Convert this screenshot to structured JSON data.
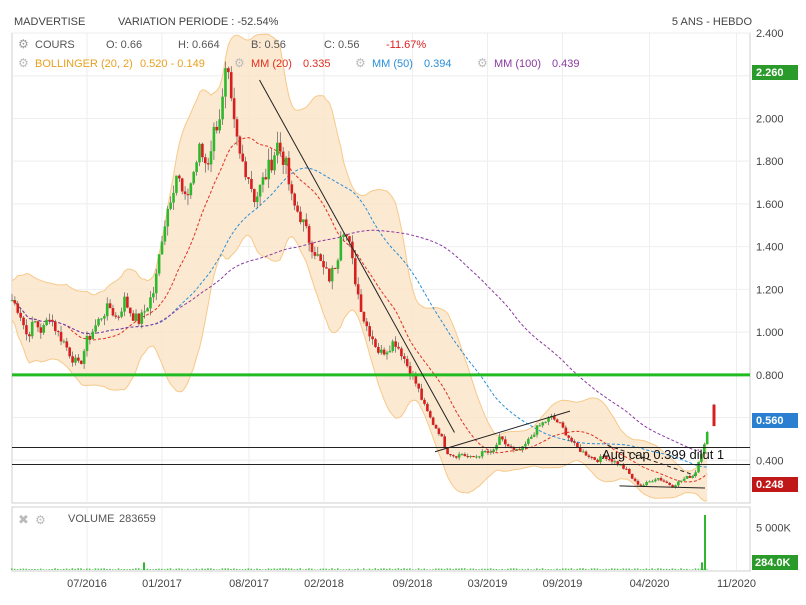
{
  "header": {
    "symbol": "MADVERTISE",
    "variation": "VARIATION PERIODE : -52.54%",
    "period": "5 ANS - HEBDO"
  },
  "legend": {
    "cours": {
      "label": "COURS",
      "o": "O: 0.66",
      "h": "H: 0.664",
      "b": "B: 0.56",
      "c": "C: 0.56",
      "chg": "-11.67%"
    },
    "bollinger": {
      "label": "BOLLINGER (20, 2)",
      "value": "0.520 - 0.149"
    },
    "mm20": {
      "label": "MM (20)",
      "value": "0.335"
    },
    "mm50": {
      "label": "MM (50)",
      "value": "0.394"
    },
    "mm100": {
      "label": "MM (100)",
      "value": "0.439"
    }
  },
  "volume_legend": {
    "label": "VOLUME",
    "value": "283659"
  },
  "badges": {
    "level_high": "2.260",
    "last_price": "0.560",
    "level_low": "0.248",
    "last_volume": "284.0K"
  },
  "annotation": "Aug cap 0.399 dilut 1",
  "colors": {
    "up": "#2db82d",
    "down": "#d62020",
    "band": "#f7c98a",
    "band_fill": "#fbe3c6",
    "mm20": "#e03020",
    "mm50": "#2a8fd8",
    "mm100": "#8a3aa0",
    "support": "#22bb22",
    "legend_orange": "#e8a020",
    "legend_blue": "#2a8fd8",
    "legend_purple": "#8a3aa0",
    "legend_red": "#e03020"
  },
  "chart_data": {
    "type": "candlestick",
    "price_axis": {
      "min": 0.2,
      "max": 2.4,
      "ticks": [
        0.4,
        0.6,
        0.8,
        1.0,
        1.2,
        1.4,
        1.6,
        1.8,
        2.0,
        2.2,
        2.4
      ],
      "tick_labels": [
        "0.400",
        "0.600",
        "0.800",
        "1.000",
        "1.200",
        "1.400",
        "1.600",
        "1.800",
        "2.000",
        "2.200",
        "2.400"
      ]
    },
    "volume_axis": {
      "ticks": [
        5000000
      ],
      "tick_labels": [
        "5 000K"
      ],
      "max": 6500000
    },
    "x_axis": {
      "min": 2016.0,
      "max": 2020.92,
      "ticks": [
        2016.5,
        2017.0,
        2017.58,
        2018.08,
        2018.67,
        2019.17,
        2019.67,
        2020.25,
        2020.83
      ],
      "tick_labels": [
        "07/2016",
        "01/2017",
        "08/2017",
        "02/2018",
        "09/2018",
        "03/2019",
        "09/2019",
        "04/2020",
        "11/2020"
      ]
    },
    "close_path": [
      [
        2016.0,
        1.15
      ],
      [
        2016.05,
        1.1
      ],
      [
        2016.1,
        0.98
      ],
      [
        2016.15,
        1.05
      ],
      [
        2016.2,
        1.0
      ],
      [
        2016.25,
        1.08
      ],
      [
        2016.3,
        1.0
      ],
      [
        2016.35,
        0.95
      ],
      [
        2016.4,
        0.88
      ],
      [
        2016.45,
        0.84
      ],
      [
        2016.5,
        0.96
      ],
      [
        2016.55,
        1.02
      ],
      [
        2016.6,
        1.08
      ],
      [
        2016.65,
        1.12
      ],
      [
        2016.7,
        1.06
      ],
      [
        2016.75,
        1.15
      ],
      [
        2016.8,
        1.08
      ],
      [
        2016.85,
        1.05
      ],
      [
        2016.9,
        1.12
      ],
      [
        2016.95,
        1.2
      ],
      [
        2017.0,
        1.45
      ],
      [
        2017.05,
        1.62
      ],
      [
        2017.1,
        1.75
      ],
      [
        2017.15,
        1.6
      ],
      [
        2017.2,
        1.72
      ],
      [
        2017.25,
        1.85
      ],
      [
        2017.3,
        1.78
      ],
      [
        2017.35,
        1.95
      ],
      [
        2017.4,
        2.05
      ],
      [
        2017.43,
        2.24
      ],
      [
        2017.47,
        2.0
      ],
      [
        2017.52,
        1.82
      ],
      [
        2017.57,
        1.75
      ],
      [
        2017.62,
        1.62
      ],
      [
        2017.67,
        1.7
      ],
      [
        2017.72,
        1.78
      ],
      [
        2017.77,
        1.88
      ],
      [
        2017.82,
        1.8
      ],
      [
        2017.87,
        1.6
      ],
      [
        2017.92,
        1.55
      ],
      [
        2017.97,
        1.45
      ],
      [
        2018.02,
        1.38
      ],
      [
        2018.07,
        1.3
      ],
      [
        2018.12,
        1.25
      ],
      [
        2018.17,
        1.35
      ],
      [
        2018.2,
        1.52
      ],
      [
        2018.25,
        1.4
      ],
      [
        2018.3,
        1.2
      ],
      [
        2018.35,
        1.05
      ],
      [
        2018.4,
        0.98
      ],
      [
        2018.45,
        0.9
      ],
      [
        2018.5,
        0.92
      ],
      [
        2018.55,
        0.96
      ],
      [
        2018.6,
        0.9
      ],
      [
        2018.65,
        0.82
      ],
      [
        2018.7,
        0.75
      ],
      [
        2018.75,
        0.65
      ],
      [
        2018.8,
        0.58
      ],
      [
        2018.85,
        0.53
      ],
      [
        2018.9,
        0.44
      ],
      [
        2018.95,
        0.42
      ],
      [
        2019.0,
        0.43
      ],
      [
        2019.05,
        0.41
      ],
      [
        2019.1,
        0.42
      ],
      [
        2019.15,
        0.44
      ],
      [
        2019.2,
        0.43
      ],
      [
        2019.25,
        0.5
      ],
      [
        2019.3,
        0.47
      ],
      [
        2019.35,
        0.44
      ],
      [
        2019.4,
        0.45
      ],
      [
        2019.45,
        0.5
      ],
      [
        2019.5,
        0.55
      ],
      [
        2019.55,
        0.58
      ],
      [
        2019.6,
        0.6
      ],
      [
        2019.65,
        0.57
      ],
      [
        2019.7,
        0.52
      ],
      [
        2019.75,
        0.47
      ],
      [
        2019.8,
        0.44
      ],
      [
        2019.85,
        0.42
      ],
      [
        2019.9,
        0.4
      ],
      [
        2019.95,
        0.42
      ],
      [
        2020.0,
        0.4
      ],
      [
        2020.05,
        0.38
      ],
      [
        2020.1,
        0.35
      ],
      [
        2020.15,
        0.3
      ],
      [
        2020.2,
        0.28
      ],
      [
        2020.25,
        0.3
      ],
      [
        2020.3,
        0.32
      ],
      [
        2020.35,
        0.3
      ],
      [
        2020.4,
        0.28
      ],
      [
        2020.45,
        0.3
      ],
      [
        2020.5,
        0.32
      ],
      [
        2020.55,
        0.33
      ],
      [
        2020.6,
        0.45
      ],
      [
        2020.65,
        0.56
      ]
    ],
    "last_candle": {
      "x": 2020.68,
      "open": 0.66,
      "high": 0.664,
      "low": 0.56,
      "close": 0.56
    },
    "support_line": 0.8,
    "horizontal_lines": [
      0.46,
      0.38
    ],
    "trendlines": [
      [
        [
          2017.65,
          2.18
        ],
        [
          2018.95,
          0.53
        ]
      ],
      [
        [
          2018.82,
          0.44
        ],
        [
          2019.72,
          0.63
        ]
      ],
      [
        [
          2020.05,
          0.28
        ],
        [
          2020.62,
          0.27
        ]
      ],
      [
        [
          2019.97,
          0.47
        ],
        [
          2020.55,
          0.33
        ]
      ]
    ],
    "volume_spikes": [
      [
        2016.88,
        900000
      ],
      [
        2020.62,
        6500000
      ],
      [
        2020.6,
        900000
      ]
    ]
  }
}
